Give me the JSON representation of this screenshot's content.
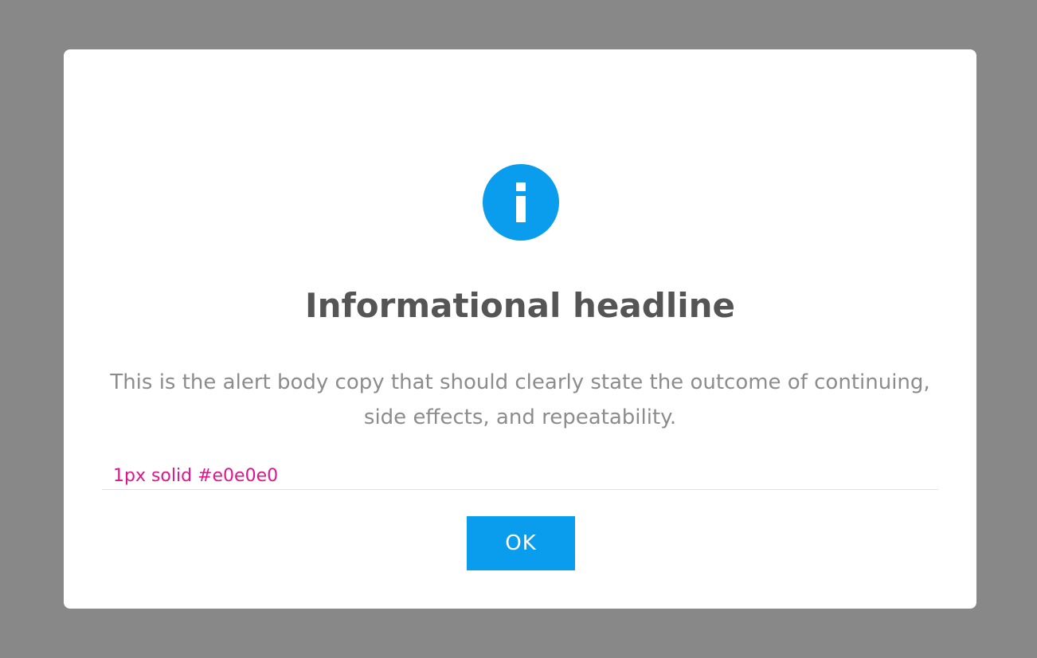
{
  "dialog": {
    "icon": "info-icon",
    "headline": "Informational headline",
    "body": "This is the alert body copy that should clearly state the outcome of continuing, side effects, and repeatability.",
    "annotation": "1px solid #e0e0e0",
    "ok_label": "OK"
  },
  "colors": {
    "overlay": "#888888",
    "accent": "#0a9ded",
    "headline": "#555555",
    "body": "#8c8c8c",
    "annotation": "#e0158c",
    "divider": "#e0e0e0"
  }
}
